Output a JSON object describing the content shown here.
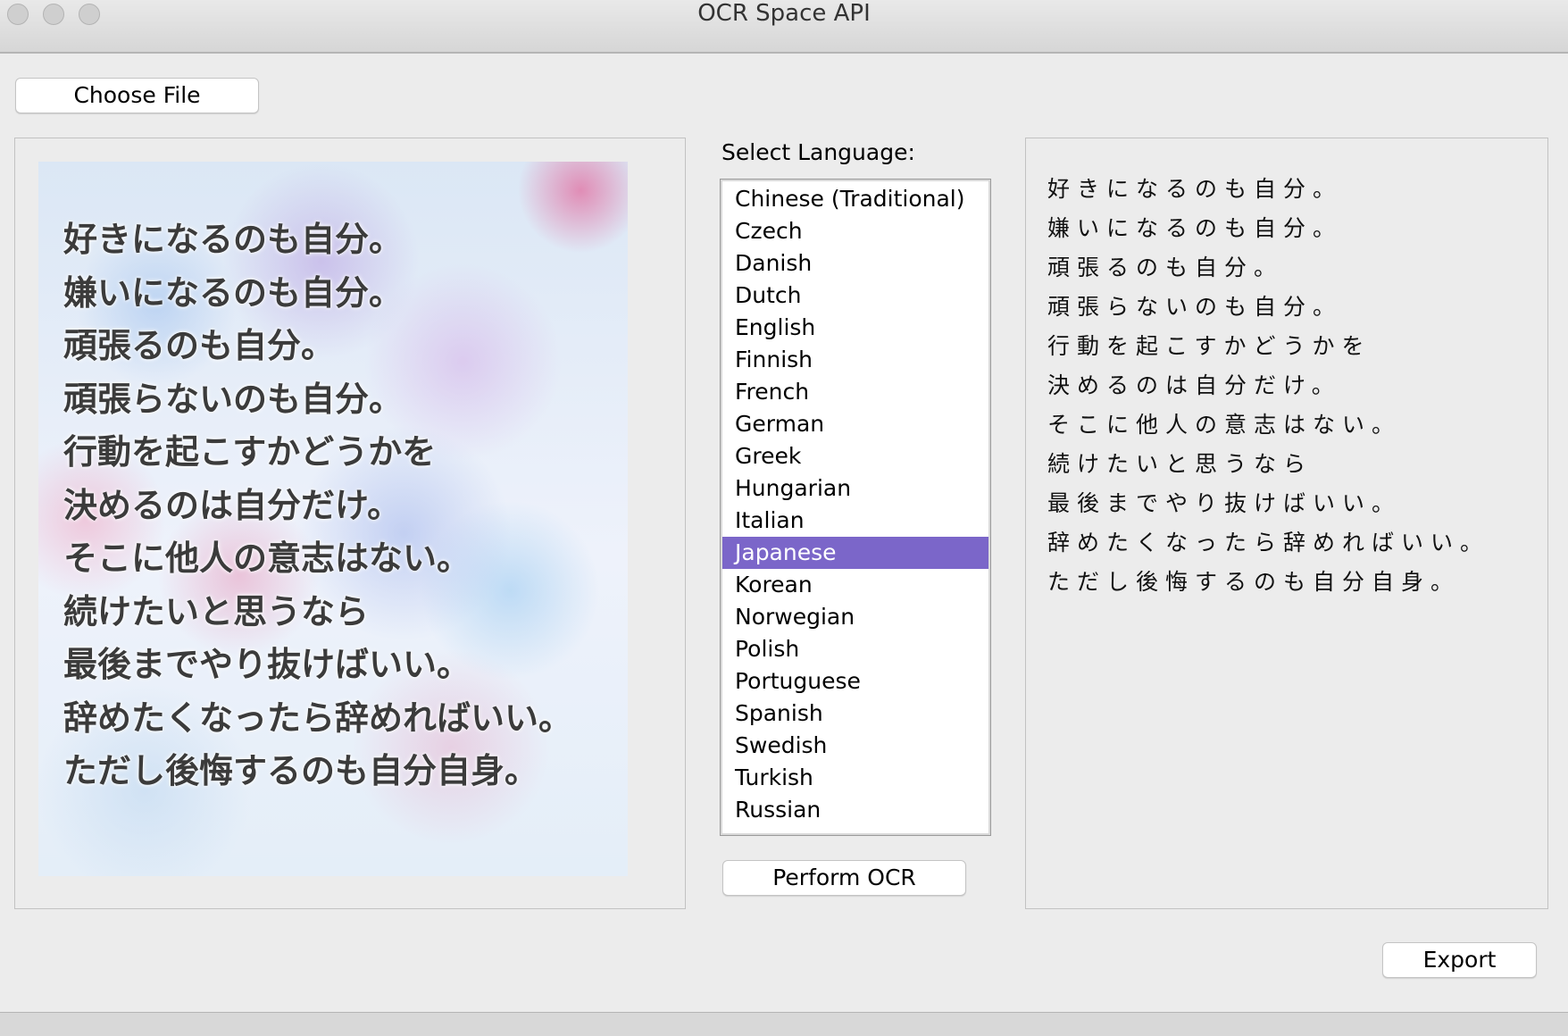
{
  "window": {
    "title": "OCR Space API"
  },
  "toolbar": {
    "choose_file_label": "Choose File"
  },
  "image": {
    "lines": [
      "好きになるのも自分。",
      "嫌いになるのも自分。",
      "頑張るのも自分。",
      "頑張らないのも自分。",
      "行動を起こすかどうかを",
      "決めるのは自分だけ。",
      "そこに他人の意志はない。",
      "続けたいと思うなら",
      "最後までやり抜けばいい。",
      "辞めたくなったら辞めればいい。",
      "ただし後悔するのも自分自身。"
    ]
  },
  "language": {
    "label": "Select Language:",
    "selected": "Japanese",
    "options": [
      "Chinese (Traditional)",
      "Czech",
      "Danish",
      "Dutch",
      "English",
      "Finnish",
      "French",
      "German",
      "Greek",
      "Hungarian",
      "Italian",
      "Japanese",
      "Korean",
      "Norwegian",
      "Polish",
      "Portuguese",
      "Spanish",
      "Swedish",
      "Turkish",
      "Russian"
    ]
  },
  "actions": {
    "perform_ocr_label": "Perform OCR",
    "export_label": "Export"
  },
  "result": {
    "lines": [
      "好きになるのも自分。",
      "嫌いになるのも自分。",
      "頑張るのも自分。",
      "頑張らないのも自分。",
      "行動を起こすかどうかを",
      "決めるのは自分だけ。",
      "そこに他人の意志はない。",
      "続けたいと思うなら",
      "最後までやり抜けばいい。",
      "辞めたくなったら辞めればいい。",
      "ただし後悔するのも自分自身。"
    ]
  },
  "colors": {
    "selection": "#7b66c9",
    "window_bg": "#ececec"
  }
}
